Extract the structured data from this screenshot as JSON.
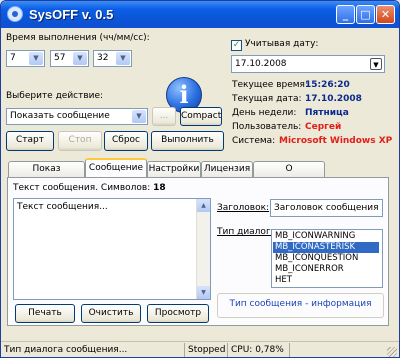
{
  "window": {
    "title": "SysOFF v. 0.5"
  },
  "exec_time": {
    "label": "Время выполнения (чч/мм/сс):",
    "hours": "7",
    "minutes": "57",
    "seconds": "32"
  },
  "action": {
    "label": "Выберите действие:",
    "selected": "Показать сообщение",
    "browse_label": "...",
    "compact_label": "Compact"
  },
  "controls": {
    "start": "Старт",
    "stop": "Стоп",
    "reset": "Сброс",
    "execute": "Выполнить"
  },
  "date_panel": {
    "checkbox_label": "Учитывая дату:",
    "checked": true,
    "date_value": "17.10.2008"
  },
  "info": {
    "time_label": "Текущее время:",
    "time_value": "15:26:20",
    "date_label": "Текущая дата:",
    "date_value": "17.10.2008",
    "weekday_label": "День недели:",
    "weekday_value": "Пятница",
    "user_label": "Пользователь:",
    "user_value": "Сергей",
    "system_label": "Система:",
    "system_value": "Microsoft Windows XP",
    "color_value_blue": "#0b2a8f",
    "color_value_red": "#e0201a"
  },
  "tabs": [
    {
      "label": "Показ диалогов"
    },
    {
      "label": "Сообщение"
    },
    {
      "label": "Настройки"
    },
    {
      "label": "Лицензия"
    },
    {
      "label": "О программе..."
    }
  ],
  "message_tab": {
    "text_label": "Текст сообщения. Символов:",
    "char_count": "18",
    "text_value": "Текст сообщения...",
    "header_label": "Заголовок:",
    "header_value": "Заголовок сообщения",
    "dialog_type_label": "Тип диалога:",
    "dialog_types": [
      "MB_ICONWARNING",
      "MB_ICONASTERISK",
      "MB_ICONQUESTION",
      "MB_ICONERROR",
      "НЕТ"
    ],
    "dialog_type_selected": "MB_ICONASTERISK",
    "type_info": "Тип сообщения - информация",
    "print_label": "Печать",
    "clear_label": "Очистить",
    "preview_label": "Просмотр"
  },
  "statusbar": {
    "hint": "Тип диалога сообщения...",
    "state": "Stopped",
    "cpu": "CPU: 0,78%"
  },
  "icons": {
    "app": "app-icon",
    "info": "info-icon",
    "minimize": "minimize-icon",
    "maximize": "maximize-icon",
    "close": "close-icon"
  }
}
